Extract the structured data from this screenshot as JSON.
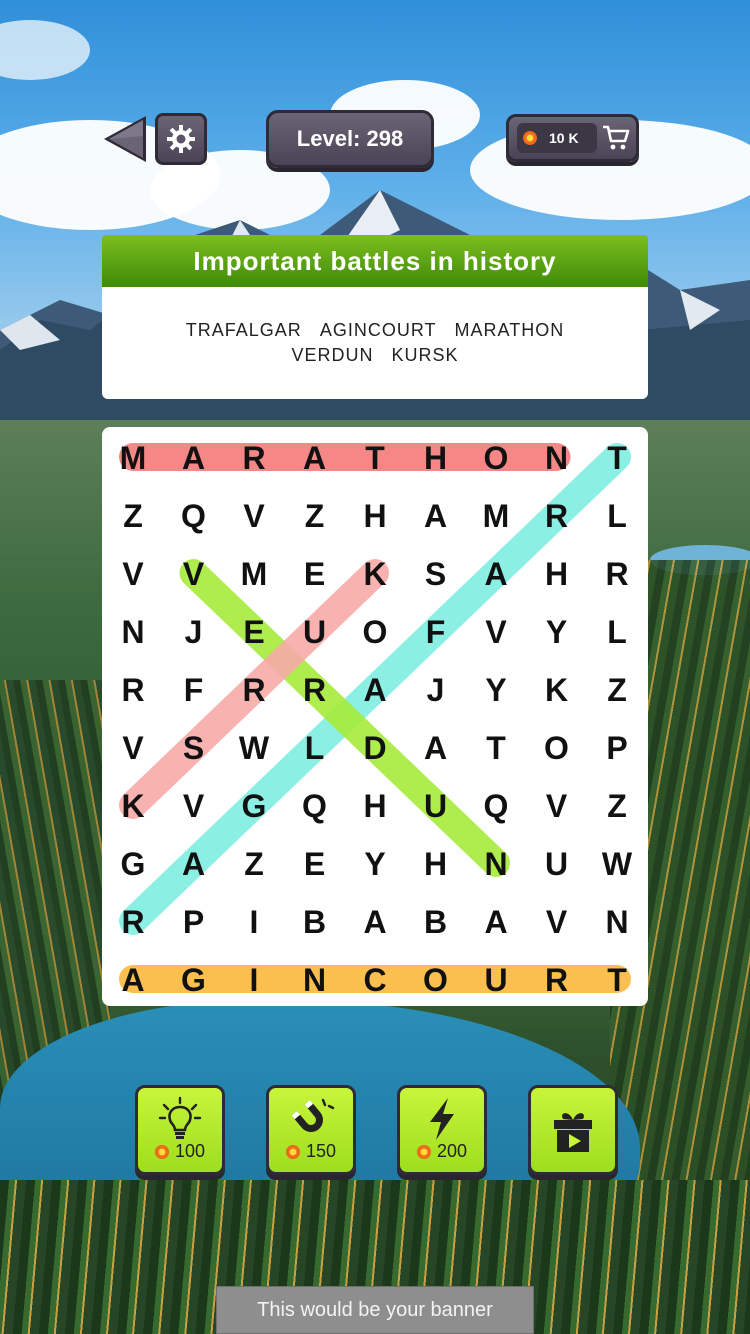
{
  "header": {
    "level_text": "Level: 298",
    "coins_text": "10 K",
    "back_icon": "back-arrow-icon",
    "settings_icon": "gear-icon",
    "cart_icon": "cart-icon"
  },
  "puzzle": {
    "theme_title": "Important battles in history",
    "words_line1": [
      "TRAFALGAR",
      "AGINCOURT",
      "MARATHON"
    ],
    "words_line2": [
      "VERDUN",
      "KURSK"
    ],
    "grid": [
      [
        "M",
        "A",
        "R",
        "A",
        "T",
        "H",
        "O",
        "N",
        "T"
      ],
      [
        "Z",
        "Q",
        "V",
        "Z",
        "H",
        "A",
        "M",
        "R",
        "L"
      ],
      [
        "V",
        "V",
        "M",
        "E",
        "K",
        "S",
        "A",
        "H",
        "R"
      ],
      [
        "N",
        "J",
        "E",
        "U",
        "O",
        "F",
        "V",
        "Y",
        "L"
      ],
      [
        "R",
        "F",
        "R",
        "R",
        "A",
        "J",
        "Y",
        "K",
        "Z"
      ],
      [
        "V",
        "S",
        "W",
        "L",
        "D",
        "A",
        "T",
        "O",
        "P"
      ],
      [
        "K",
        "V",
        "G",
        "Q",
        "H",
        "U",
        "Q",
        "V",
        "Z"
      ],
      [
        "G",
        "A",
        "Z",
        "E",
        "Y",
        "H",
        "N",
        "U",
        "W"
      ],
      [
        "R",
        "P",
        "I",
        "B",
        "A",
        "B",
        "A",
        "V",
        "N"
      ],
      [
        "A",
        "G",
        "I",
        "N",
        "C",
        "O",
        "U",
        "R",
        "T"
      ]
    ],
    "found_words": [
      {
        "word": "MARATHON",
        "color": "#f47b7b",
        "from": [
          0,
          0
        ],
        "to": [
          0,
          7
        ]
      },
      {
        "word": "AGINCOURT",
        "color": "#fbb93d",
        "from": [
          9,
          0
        ],
        "to": [
          9,
          8
        ]
      },
      {
        "word": "TRAFALGAR",
        "color": "#7fefe0",
        "from": [
          0,
          8
        ],
        "to": [
          8,
          0
        ]
      },
      {
        "word": "VERDUN",
        "color": "#a6ec3a",
        "from": [
          2,
          1
        ],
        "to": [
          7,
          6
        ]
      },
      {
        "word": "KURSK",
        "color": "#f8aaa8",
        "from": [
          2,
          4
        ],
        "to": [
          6,
          0
        ]
      }
    ]
  },
  "powerups": [
    {
      "name": "hint",
      "icon": "lightbulb-icon",
      "cost": "100"
    },
    {
      "name": "magnet",
      "icon": "magnet-icon",
      "cost": "150"
    },
    {
      "name": "lightning",
      "icon": "lightning-icon",
      "cost": "200"
    },
    {
      "name": "free-video",
      "icon": "gift-video-icon",
      "cost": ""
    }
  ],
  "banner": {
    "text": "This would be your banner"
  }
}
